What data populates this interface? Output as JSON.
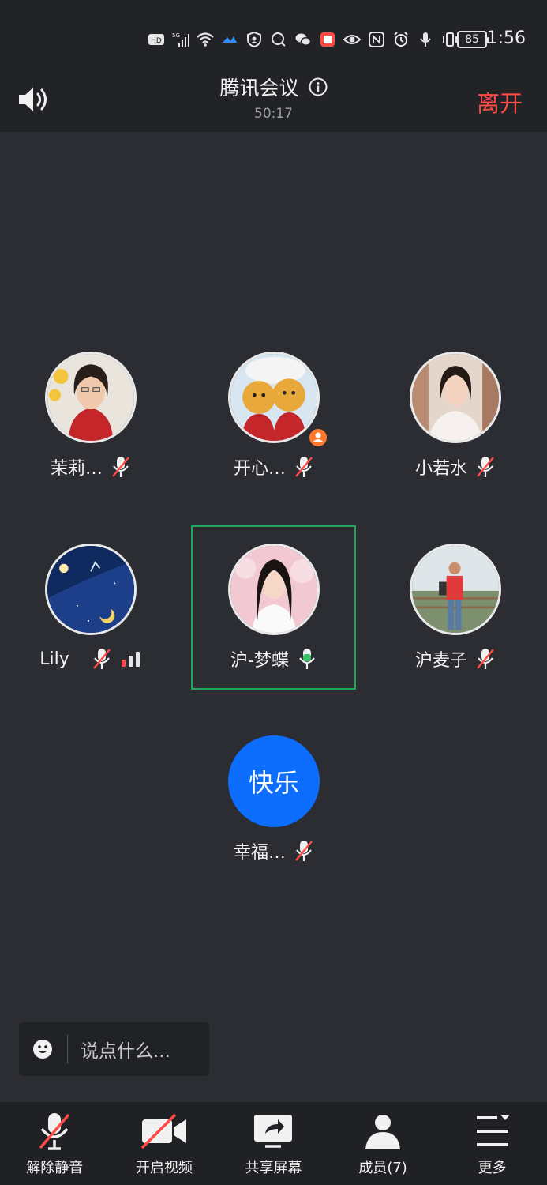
{
  "status_bar": {
    "icons": [
      "hd-icon",
      "5g-signal-icon",
      "wifi-icon",
      "app-notification-icon",
      "shield-icon",
      "chat-bubble-icon",
      "wechat-icon",
      "red-app-icon",
      "eye-icon",
      "nfc-icon",
      "alarm-icon",
      "mic-icon",
      "vibrate-icon"
    ],
    "hd_label": "HD",
    "network_label": "5G",
    "battery": "85",
    "time": "1:56"
  },
  "header": {
    "title": "腾讯会议",
    "timer": "50:17",
    "leave_label": "离开"
  },
  "participants": [
    {
      "name": "茉莉…",
      "mic": "muted",
      "avatar": "photo"
    },
    {
      "name": "开心…",
      "mic": "muted",
      "avatar": "photo",
      "host": true
    },
    {
      "name": "小若水",
      "mic": "muted",
      "avatar": "photo"
    },
    {
      "name": "Lily",
      "mic": "muted",
      "avatar": "photo",
      "signal": "network-signal-icon"
    },
    {
      "name": "沪-梦蝶",
      "mic": "active",
      "avatar": "photo",
      "speaking": true
    },
    {
      "name": "沪麦子",
      "mic": "muted",
      "avatar": "photo"
    },
    {
      "name": "幸福…",
      "mic": "muted",
      "avatar_text": "快乐"
    }
  ],
  "chat": {
    "placeholder": "说点什么..."
  },
  "toolbar": {
    "unmute_label": "解除静音",
    "video_label": "开启视频",
    "share_label": "共享屏幕",
    "members_label": "成员(7)",
    "more_label": "更多"
  },
  "colors": {
    "leave": "#ff4b45",
    "active_speaker_frame": "#1fa75a",
    "mic_active": "#3ac16a",
    "mic_muted_slash": "#ff4b45",
    "text_avatar": "#0d6efd",
    "host_badge": "#ff7a2d"
  }
}
